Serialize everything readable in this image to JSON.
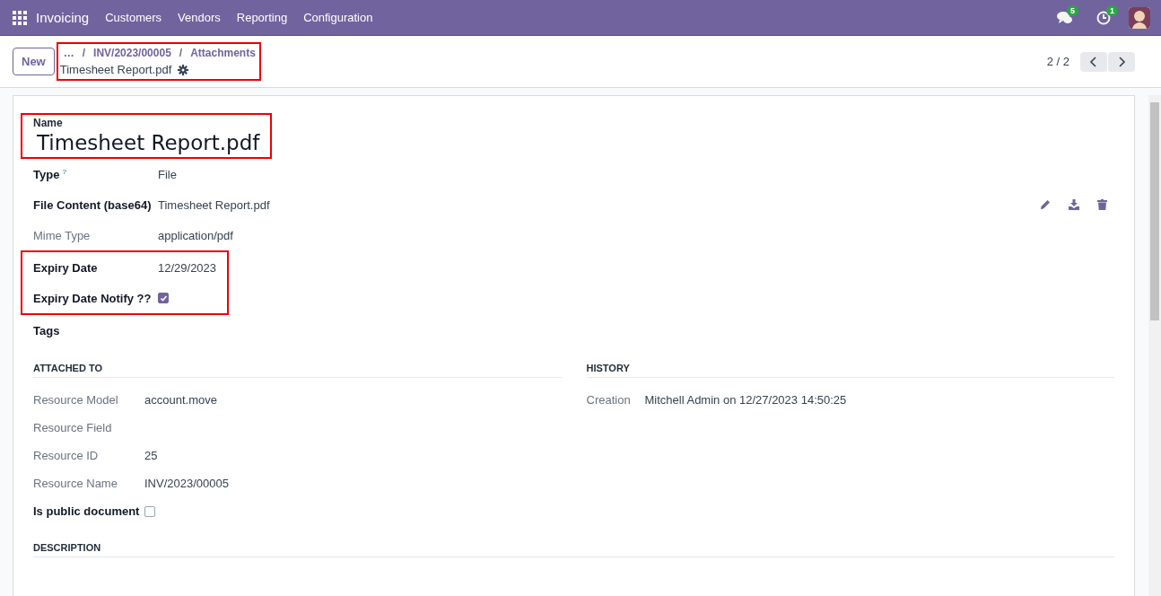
{
  "navbar": {
    "app_name": "Invoicing",
    "menu": [
      "Customers",
      "Vendors",
      "Reporting",
      "Configuration"
    ],
    "messages_count": "5",
    "activities_count": "1"
  },
  "control_panel": {
    "new_button": "New",
    "highlighted": true,
    "breadcrumbs": [
      "…",
      "INV/2023/00005",
      "Attachments"
    ],
    "separator": "/",
    "record_title": "Timesheet Report.pdf",
    "pager": "2 / 2"
  },
  "form": {
    "highlighted": true,
    "name_label": "Name",
    "name": "Timesheet Report.pdf",
    "fields": [
      {
        "kind": "text",
        "label": "Type",
        "help": "?",
        "value": "File",
        "readonly": false,
        "highlighted": false
      },
      {
        "kind": "file",
        "label": "File Content (base64)",
        "value": "Timesheet Report.pdf",
        "readonly": false,
        "highlighted": false
      },
      {
        "kind": "text",
        "label": "Mime Type",
        "value": "application/pdf",
        "readonly": true,
        "highlighted": false
      },
      {
        "kind": "text",
        "label": "Expiry Date",
        "value": "12/29/2023",
        "readonly": false,
        "highlighted": true
      },
      {
        "kind": "checkbox",
        "label": "Expiry Date Notify ??",
        "checked": true,
        "readonly": false,
        "highlighted": true
      },
      {
        "kind": "text",
        "label": "Tags",
        "readonly": false,
        "highlighted": false
      }
    ],
    "attached_to": {
      "title": "ATTACHED TO",
      "rows": [
        {
          "kind": "text",
          "label": "Resource Model",
          "value": "account.move",
          "readonly": true
        },
        {
          "kind": "text",
          "label": "Resource Field",
          "readonly": true
        },
        {
          "kind": "text",
          "label": "Resource ID",
          "value": "25",
          "readonly": true
        },
        {
          "kind": "text",
          "label": "Resource Name",
          "value": "INV/2023/00005",
          "readonly": true
        },
        {
          "kind": "checkbox",
          "label": "Is public document",
          "checked": false,
          "readonly": false
        }
      ]
    },
    "history": {
      "title": "HISTORY",
      "rows": [
        {
          "label": "Creation",
          "value": "Mitchell Admin on 12/27/2023 14:50:25",
          "readonly": true
        }
      ]
    },
    "description": {
      "title": "DESCRIPTION"
    }
  }
}
